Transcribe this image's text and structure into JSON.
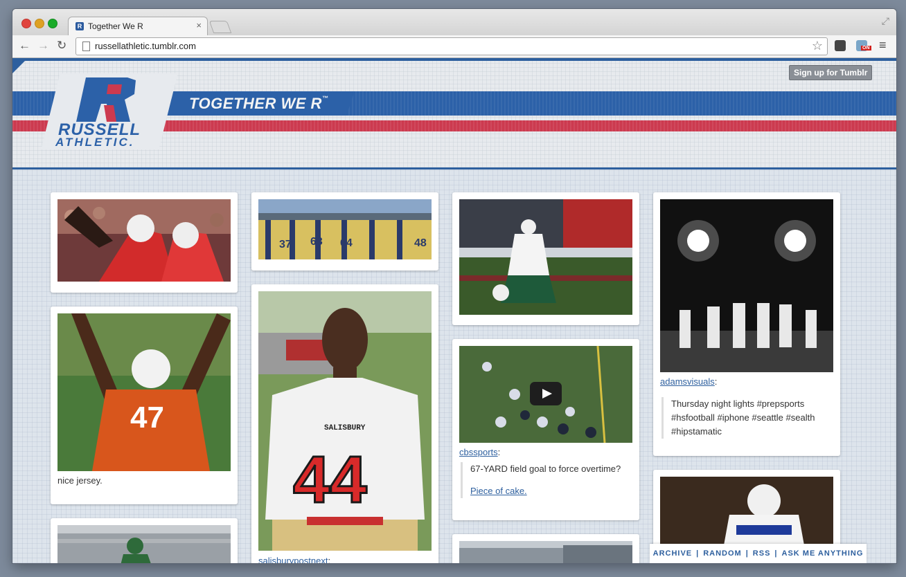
{
  "browser": {
    "tab_title": "Together We R",
    "tab_favicon": "R",
    "tab_close": "×",
    "url": "russellathletic.tumblr.com",
    "back": "←",
    "forward": "→",
    "reload": "↻",
    "star": "☆",
    "menu": "≡",
    "resize": "⤢",
    "ext_badge": "ON"
  },
  "header": {
    "tagline": "TOGETHER WE R",
    "tagline_tm": "™",
    "logo_russell": "RUSSELL",
    "logo_athletic": "ATHLETIC.",
    "signup": "Sign up for Tumblr",
    "colors": {
      "blue": "#2c61a8",
      "red": "#cc3a4f"
    }
  },
  "posts": {
    "p1": {},
    "p2": {
      "caption": "nice jersey."
    },
    "p4": {},
    "p5": {
      "source": "salisburypostnext",
      "colon": ":"
    },
    "p6": {},
    "p7": {
      "source": "cbssports",
      "colon": ":",
      "quote": "67-YARD field goal to force overtime?",
      "link": "Piece of cake."
    },
    "p8": {
      "source": "adamsvisuals",
      "colon": ":",
      "quote": "Thursday night lights #prepsports #hsfootball #iphone #seattle #sealth #hipstamatic"
    }
  },
  "footer": {
    "archive": "ARCHIVE",
    "random": "RANDOM",
    "rss": "RSS",
    "ask": "ASK ME ANYTHING",
    "sep": "|"
  }
}
